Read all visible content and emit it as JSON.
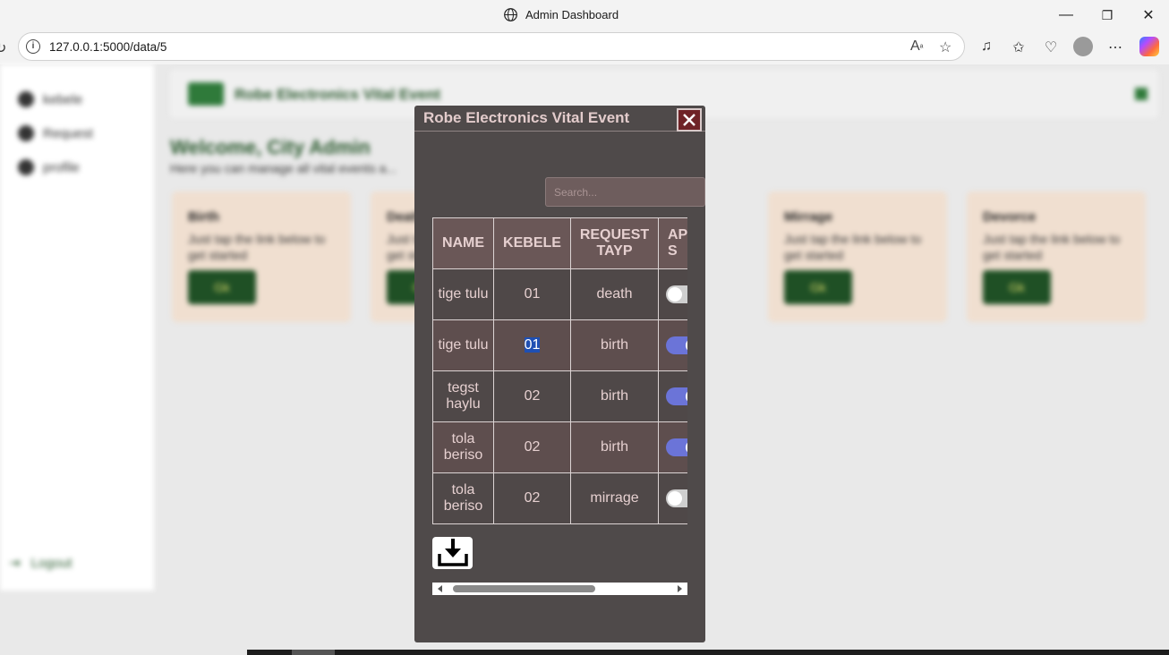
{
  "browser": {
    "window_title": "Admin Dashboard",
    "url": "127.0.0.1:5000/data/5",
    "controls": {
      "minimize": "—",
      "restore": "❐",
      "close": "✕"
    }
  },
  "page": {
    "brand": "Robe Electronics Vital Event",
    "welcome": "Welcome, City Admin",
    "subtitle": "Here you can manage all vital events a...",
    "sidebar": [
      {
        "label": "kebele"
      },
      {
        "label": "Request"
      },
      {
        "label": "profile"
      }
    ],
    "logout": "Logout",
    "cards": [
      {
        "title": "Birth",
        "text": "Just tap the link below to get started",
        "button": "Gk"
      },
      {
        "title": "Death",
        "text": "Just tap the link below to get started",
        "button": "Gk"
      },
      {
        "title": "Mirrage",
        "text": "Just tap the link below to get started",
        "button": "Gk"
      },
      {
        "title": "Devorce",
        "text": "Just tap the link below to get started",
        "button": "Gk"
      }
    ]
  },
  "modal": {
    "title": "Robe Electronics Vital Event",
    "search_placeholder": "Search...",
    "columns": [
      "NAME",
      "KEBELE",
      "REQUEST TAYP",
      "APPROVE S"
    ],
    "rows": [
      {
        "name": "tige tulu",
        "kebele": "01",
        "request": "death",
        "approved": false
      },
      {
        "name": "tige tulu",
        "kebele": "01",
        "request": "birth",
        "approved": true,
        "kebele_selected": true
      },
      {
        "name": "tegst haylu",
        "kebele": "02",
        "request": "birth",
        "approved": true
      },
      {
        "name": "tola beriso",
        "kebele": "02",
        "request": "birth",
        "approved": true
      },
      {
        "name": "tola beriso",
        "kebele": "02",
        "request": "mirrage",
        "approved": false
      }
    ]
  },
  "colors": {
    "modal_bg": "#4f4a4a",
    "toggle_on": "#6b74d8",
    "close_bg": "#6f2327"
  }
}
